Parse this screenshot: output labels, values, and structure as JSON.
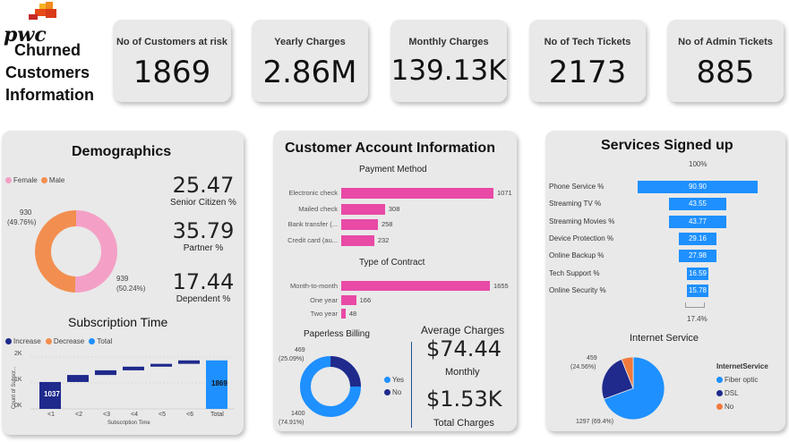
{
  "header": {
    "logo_text": "pwc",
    "title_line1": "Churned",
    "title_line2": "Customers",
    "title_line3": "Information"
  },
  "kpis": [
    {
      "label": "No of Customers at risk",
      "value": "1869"
    },
    {
      "label": "Yearly Charges",
      "value": "2.86M"
    },
    {
      "label": "Monthly Charges",
      "value": "139.13K"
    },
    {
      "label": "No of Tech Tickets",
      "value": "2173"
    },
    {
      "label": "No of Admin Tickets",
      "value": "885"
    }
  ],
  "demographics": {
    "title": "Demographics",
    "legend_female": "Female",
    "legend_male": "Male",
    "male_label_count": "930",
    "male_label_pct": "(49.76%)",
    "female_label_count": "939",
    "female_label_pct": "(50.24%)",
    "senior_value": "25.47",
    "senior_label": "Senior Citizen %",
    "partner_value": "35.79",
    "partner_label": "Partner %",
    "dependent_value": "17.44",
    "dependent_label": "Dependent %",
    "colors": {
      "female": "#f4a0c6",
      "male": "#f28f50"
    }
  },
  "subscription": {
    "title": "Subscription Time",
    "legend_increase": "Increase",
    "legend_decrease": "Decrease",
    "legend_total": "Total",
    "ylabel": "Count of Subscr...",
    "xlabel": "Subscription Time",
    "yticks": [
      "2K",
      "1K",
      "0K"
    ],
    "first_label": "1037",
    "total_label": "1869",
    "colors": {
      "increase": "#1f2a8c",
      "decrease": "#f28f50",
      "total": "#1e90ff"
    }
  },
  "account": {
    "title": "Customer Account Information",
    "payment_title": "Payment Method",
    "contract_title": "Type of Contract",
    "paperless_title": "Paperless Billing",
    "paperless_yes_label": "Yes",
    "paperless_no_label": "No",
    "paperless_no_count": "469",
    "paperless_no_pct": "(25.09%)",
    "paperless_yes_count": "1400",
    "paperless_yes_pct": "(74.91%)",
    "avg_title": "Average Charges",
    "avg_monthly_value": "$74.44",
    "avg_monthly_label": "Monthly",
    "avg_total_value": "$1.53K",
    "avg_total_label": "Total Charges",
    "bar_color": "#e84aa6"
  },
  "services": {
    "title": "Services Signed up",
    "top_label": "100%",
    "bottom_label": "17.4%",
    "internet_title": "Internet Service",
    "internet_legend_title": "InternetService",
    "internet_dsl_count": "459",
    "internet_dsl_pct": "(24.56%)",
    "internet_fiber_count": "1297",
    "internet_fiber_pct": "(69.4%)",
    "funnel_color": "#1e90ff"
  },
  "chart_data": [
    {
      "type": "pie",
      "name": "Demographics gender donut",
      "categories": [
        "Female",
        "Male"
      ],
      "values": [
        939,
        930
      ],
      "percentages": [
        50.24,
        49.76
      ]
    },
    {
      "type": "bar",
      "name": "Subscription Time waterfall",
      "categories": [
        "<1",
        "<2",
        "<3",
        "<4",
        "<5",
        "<6",
        "Total"
      ],
      "values": [
        1037,
        270,
        180,
        140,
        110,
        132,
        1869
      ],
      "ylim": [
        0,
        2000
      ],
      "xlabel": "Subscription Time",
      "ylabel": "Count of Subscr..."
    },
    {
      "type": "bar",
      "name": "Payment Method",
      "categories": [
        "Electronic check",
        "Mailed check",
        "Bank transfer (...",
        "Credit card (au..."
      ],
      "values": [
        1071,
        308,
        258,
        232
      ]
    },
    {
      "type": "bar",
      "name": "Type of Contract",
      "categories": [
        "Month-to-month",
        "One year",
        "Two year"
      ],
      "values": [
        1655,
        166,
        48
      ]
    },
    {
      "type": "pie",
      "name": "Paperless Billing",
      "categories": [
        "Yes",
        "No"
      ],
      "values": [
        1400,
        469
      ],
      "percentages": [
        74.91,
        25.09
      ]
    },
    {
      "type": "bar",
      "name": "Services Signed up funnel",
      "categories": [
        "Phone Service %",
        "Streaming TV %",
        "Streaming Movies %",
        "Device Protection %",
        "Online Backup %",
        "Tech Support %",
        "Online Security %"
      ],
      "values": [
        90.9,
        43.55,
        43.77,
        29.16,
        27.98,
        16.59,
        15.78
      ]
    },
    {
      "type": "pie",
      "name": "Internet Service",
      "categories": [
        "Fiber optic",
        "DSL",
        "No"
      ],
      "values": [
        1297,
        459,
        113
      ],
      "colors": [
        "#1e90ff",
        "#1f2a8c",
        "#f07a3c"
      ]
    }
  ]
}
